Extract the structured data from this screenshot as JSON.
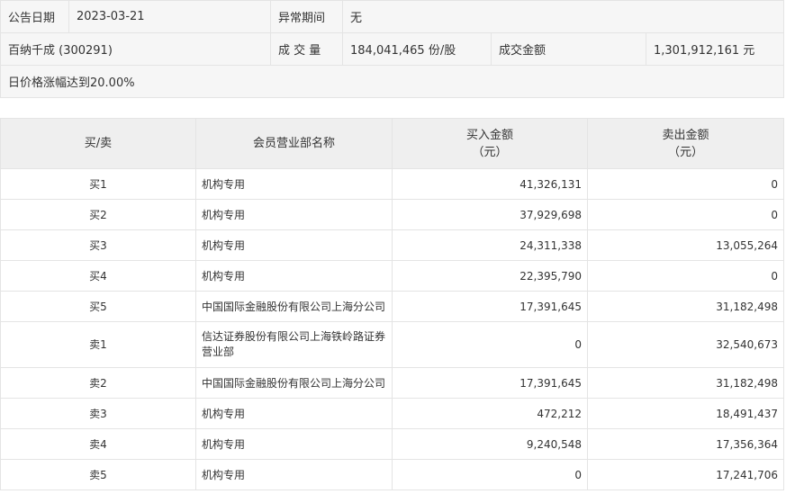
{
  "info": {
    "date_label": "公告日期",
    "date_value": "2023-03-21",
    "period_label": "异常期间",
    "period_value": "无",
    "stock_name": "百纳千成 (300291)",
    "volume_label": "成 交 量",
    "volume_value": "184,041,465 份/股",
    "amount_label": "成交金额",
    "amount_value": "1,301,912,161 元",
    "reason": "日价格涨幅达到20.00%"
  },
  "table": {
    "headers": {
      "side": "买/卖",
      "branch": "会员营业部名称",
      "buy_line1": "买入金额",
      "buy_line2": "（元）",
      "sell_line1": "卖出金额",
      "sell_line2": "（元）"
    },
    "rows": [
      {
        "side": "买1",
        "branch": "机构专用",
        "buy": "41,326,131",
        "sell": "0"
      },
      {
        "side": "买2",
        "branch": "机构专用",
        "buy": "37,929,698",
        "sell": "0"
      },
      {
        "side": "买3",
        "branch": "机构专用",
        "buy": "24,311,338",
        "sell": "13,055,264"
      },
      {
        "side": "买4",
        "branch": "机构专用",
        "buy": "22,395,790",
        "sell": "0"
      },
      {
        "side": "买5",
        "branch": "中国国际金融股份有限公司上海分公司",
        "buy": "17,391,645",
        "sell": "31,182,498"
      },
      {
        "side": "卖1",
        "branch_line1": "信达证券股份有限公司上海铁岭路证券",
        "branch_line2": "营业部",
        "buy": "0",
        "sell": "32,540,673"
      },
      {
        "side": "卖2",
        "branch": "中国国际金融股份有限公司上海分公司",
        "buy": "17,391,645",
        "sell": "31,182,498"
      },
      {
        "side": "卖3",
        "branch": "机构专用",
        "buy": "472,212",
        "sell": "18,491,437"
      },
      {
        "side": "卖4",
        "branch": "机构专用",
        "buy": "9,240,548",
        "sell": "17,356,364"
      },
      {
        "side": "卖5",
        "branch": "机构专用",
        "buy": "0",
        "sell": "17,241,706"
      }
    ]
  }
}
